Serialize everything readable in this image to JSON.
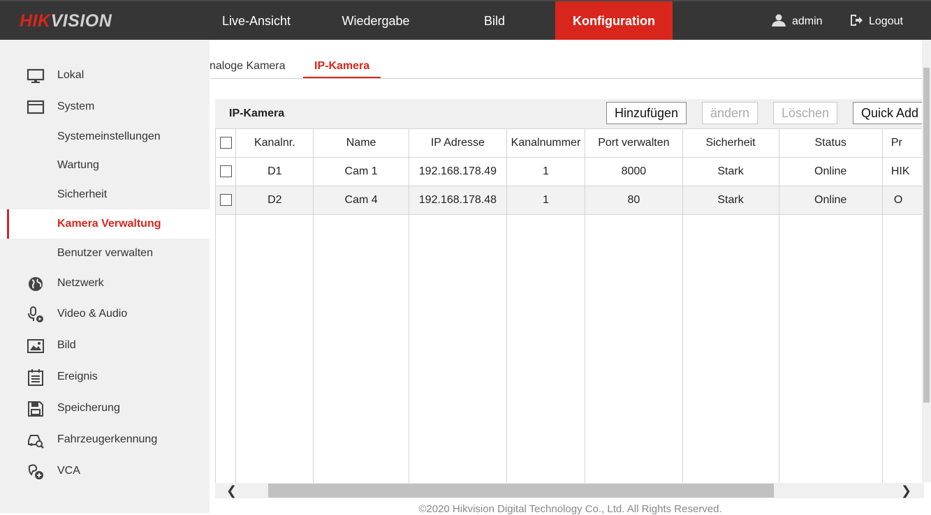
{
  "brand": {
    "part1": "HIK",
    "part2": "VISION"
  },
  "nav": {
    "live": "Live-Ansicht",
    "playback": "Wiedergabe",
    "picture": "Bild",
    "config": "Konfiguration"
  },
  "user": {
    "name": "admin",
    "logout": "Logout"
  },
  "sidebar": {
    "local": "Lokal",
    "system": "System",
    "system_settings": "Systemeinstellungen",
    "maintenance": "Wartung",
    "security": "Sicherheit",
    "camera_mgmt": "Kamera Verwaltung",
    "user_mgmt": "Benutzer verwalten",
    "network": "Netzwerk",
    "video_audio": "Video & Audio",
    "image": "Bild",
    "event": "Ereignis",
    "storage": "Speicherung",
    "vehicle": "Fahrzeugerkennung",
    "vca": "VCA"
  },
  "tabs": {
    "analog": "naloge Kamera",
    "ip": "IP-Kamera"
  },
  "panel": {
    "title": "IP-Kamera",
    "add": "Hinzufügen",
    "modify": "ändern",
    "delete": "Löschen",
    "quick_add": "Quick Add"
  },
  "table": {
    "headers": [
      "Kanalnr.",
      "Name",
      "IP Adresse",
      "Kanalnummer",
      "Port verwalten",
      "Sicherheit",
      "Status",
      "Pr"
    ],
    "rows": [
      [
        "D1",
        "Cam 1",
        "192.168.178.49",
        "1",
        "8000",
        "Stark",
        "Online",
        "HIK"
      ],
      [
        "D2",
        "Cam 4",
        "192.168.178.48",
        "1",
        "80",
        "Stark",
        "Online",
        "O"
      ]
    ]
  },
  "footer": "©2020 Hikvision Digital Technology Co., Ltd. All Rights Reserved.",
  "colors": {
    "accent": "#d9261c",
    "topbar": "#363636",
    "sidebar": "#f0f0f0"
  }
}
